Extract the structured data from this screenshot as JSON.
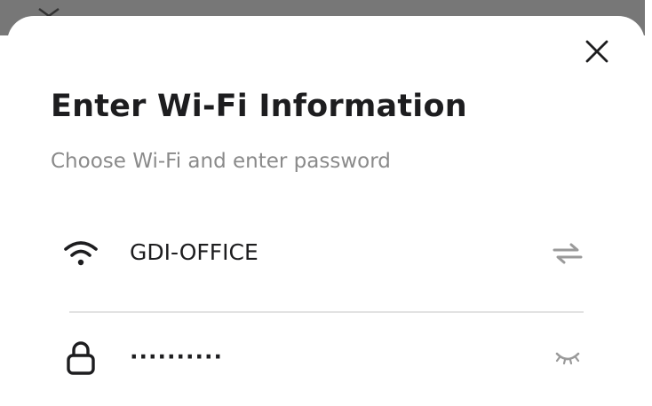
{
  "dialog": {
    "title": "Enter Wi-Fi Information",
    "subtitle": "Choose Wi-Fi and enter password"
  },
  "wifi": {
    "ssid": "GDI-OFFICE",
    "lead_icon": "wifi-icon",
    "trail_icon": "swap-icon"
  },
  "password": {
    "masked_value": "··········",
    "lead_icon": "lock-icon",
    "trail_icon": "eye-closed-icon"
  },
  "colors": {
    "title": "#1d1d1f",
    "subtitle": "#8a8a8a",
    "icon_muted": "#9a9a9a",
    "divider": "#e2e2e2",
    "backdrop": "#777777"
  }
}
